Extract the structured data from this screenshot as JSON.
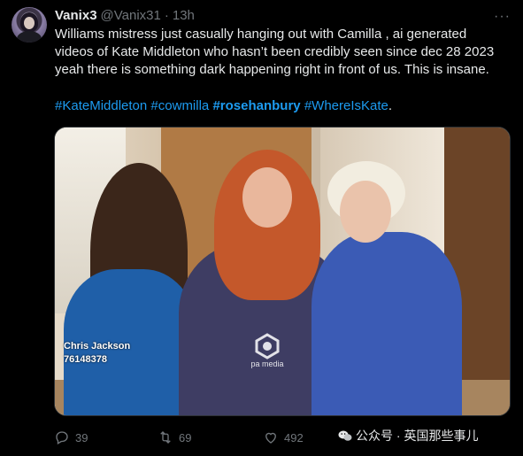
{
  "tweet": {
    "author_name": "Vanix3",
    "handle": "@Vanix31",
    "separator": "·",
    "time": "13h",
    "more_label": "···",
    "lines": [
      "Williams mistress just casually hanging out with Camilla , ai generated",
      "videos of Kate Middleton who hasn’t been credibly seen since dec 28 2023",
      "yeah there is something dark happening right in front of us. This is insane."
    ],
    "hashtags": [
      "#KateMiddleton",
      "#cowmilla",
      "#rosehanbury",
      "#WhereIsKate"
    ],
    "hashtags_end": "."
  },
  "photo": {
    "credit_name": "Chris Jackson",
    "credit_id": "76148378",
    "watermark_text": "pa media"
  },
  "actions": {
    "replies": "39",
    "retweets": "69",
    "likes": "492"
  },
  "overlay": {
    "wechat_text": "公众号 · 英国那些事儿"
  },
  "colors": {
    "background": "#000000",
    "text": "#e7e9ea",
    "muted": "#71767b",
    "link": "#1d9bf0"
  }
}
